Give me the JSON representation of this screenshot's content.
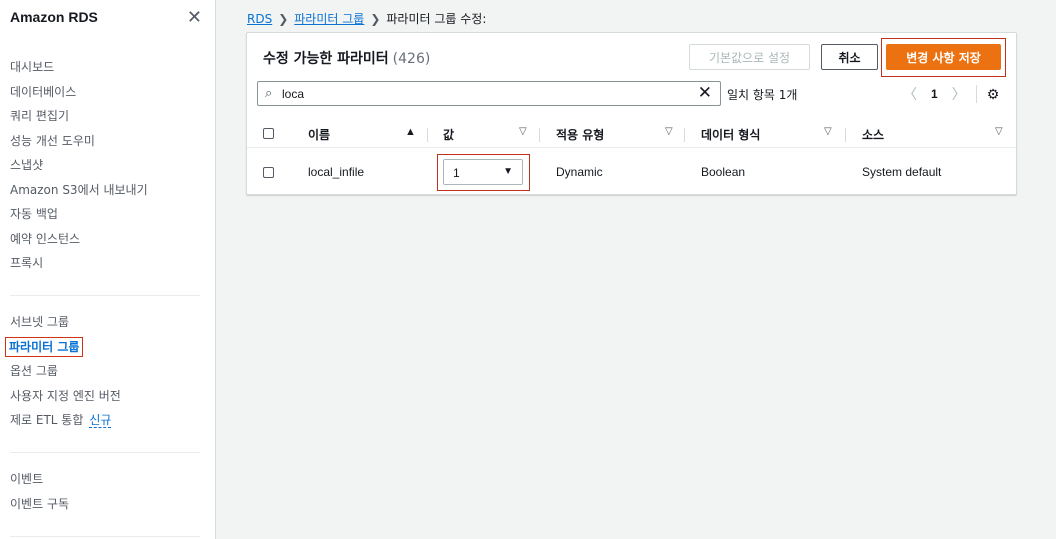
{
  "sidebar": {
    "title": "Amazon RDS",
    "groups": [
      [
        "대시보드",
        "데이터베이스",
        "쿼리 편집기",
        "성능 개선 도우미",
        "스냅샷",
        "Amazon S3에서 내보내기",
        "자동 백업",
        "예약 인스턴스",
        "프록시"
      ],
      [
        "서브넷 그룹",
        "파라미터 그룹",
        "옵션 그룹",
        "사용자 지정 엔진 버전",
        "제로 ETL 통합"
      ],
      [
        "이벤트",
        "이벤트 구독"
      ]
    ],
    "active_item": "파라미터 그룹",
    "new_badge": "신규"
  },
  "breadcrumb": {
    "items": [
      "RDS",
      "파라미터 그룹"
    ],
    "current": "파라미터 그룹 수정:"
  },
  "panel": {
    "title": "수정 가능한 파라미터",
    "count": "(426)",
    "buttons": {
      "reset": "기본값으로 설정",
      "cancel": "취소",
      "save": "변경 사항 저장"
    },
    "search": {
      "value": "loca"
    },
    "match_text": "일치 항목 1개",
    "page": "1",
    "columns": [
      "이름",
      "값",
      "적용 유형",
      "데이터 형식",
      "소스"
    ],
    "rows": [
      {
        "name": "local_infile",
        "value": "1",
        "apply_type": "Dynamic",
        "data_type": "Boolean",
        "source": "System default"
      }
    ]
  },
  "colors": {
    "accent": "#0972d3",
    "primary_button": "#ec7211",
    "highlight_outline": "#c3311c"
  }
}
